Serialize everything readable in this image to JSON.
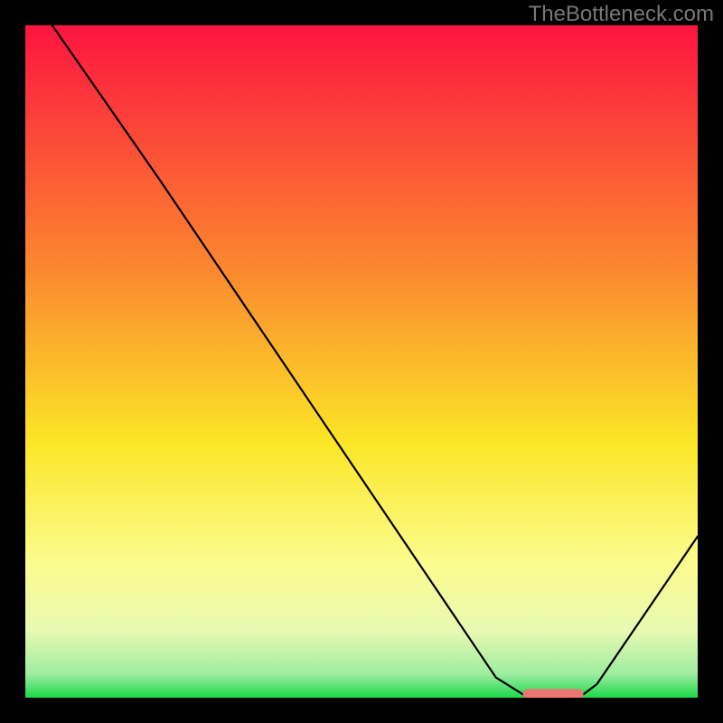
{
  "watermark": "TheBottleneck.com",
  "chart_data": {
    "type": "line",
    "title": "",
    "xlabel": "",
    "ylabel": "",
    "xlim": [
      0,
      100
    ],
    "ylim": [
      0,
      100
    ],
    "grid": false,
    "legend": false,
    "series": [
      {
        "name": "curve",
        "x": [
          4,
          20,
          70,
          74,
          83,
          85,
          100
        ],
        "y": [
          100,
          77,
          3,
          0.5,
          0.5,
          2,
          24
        ]
      }
    ],
    "marker": {
      "x_start": 74,
      "x_end": 83,
      "y": 0.5,
      "color": "#ed7672"
    },
    "gradient_stops": [
      {
        "offset": 0.0,
        "color": "#fd1440"
      },
      {
        "offset": 0.38,
        "color": "#fb8e2e"
      },
      {
        "offset": 0.62,
        "color": "#fbe626"
      },
      {
        "offset": 0.8,
        "color": "#fbfc8e"
      },
      {
        "offset": 0.9,
        "color": "#e9f9b2"
      },
      {
        "offset": 0.965,
        "color": "#9deda0"
      },
      {
        "offset": 1.0,
        "color": "#1cd948"
      }
    ]
  }
}
